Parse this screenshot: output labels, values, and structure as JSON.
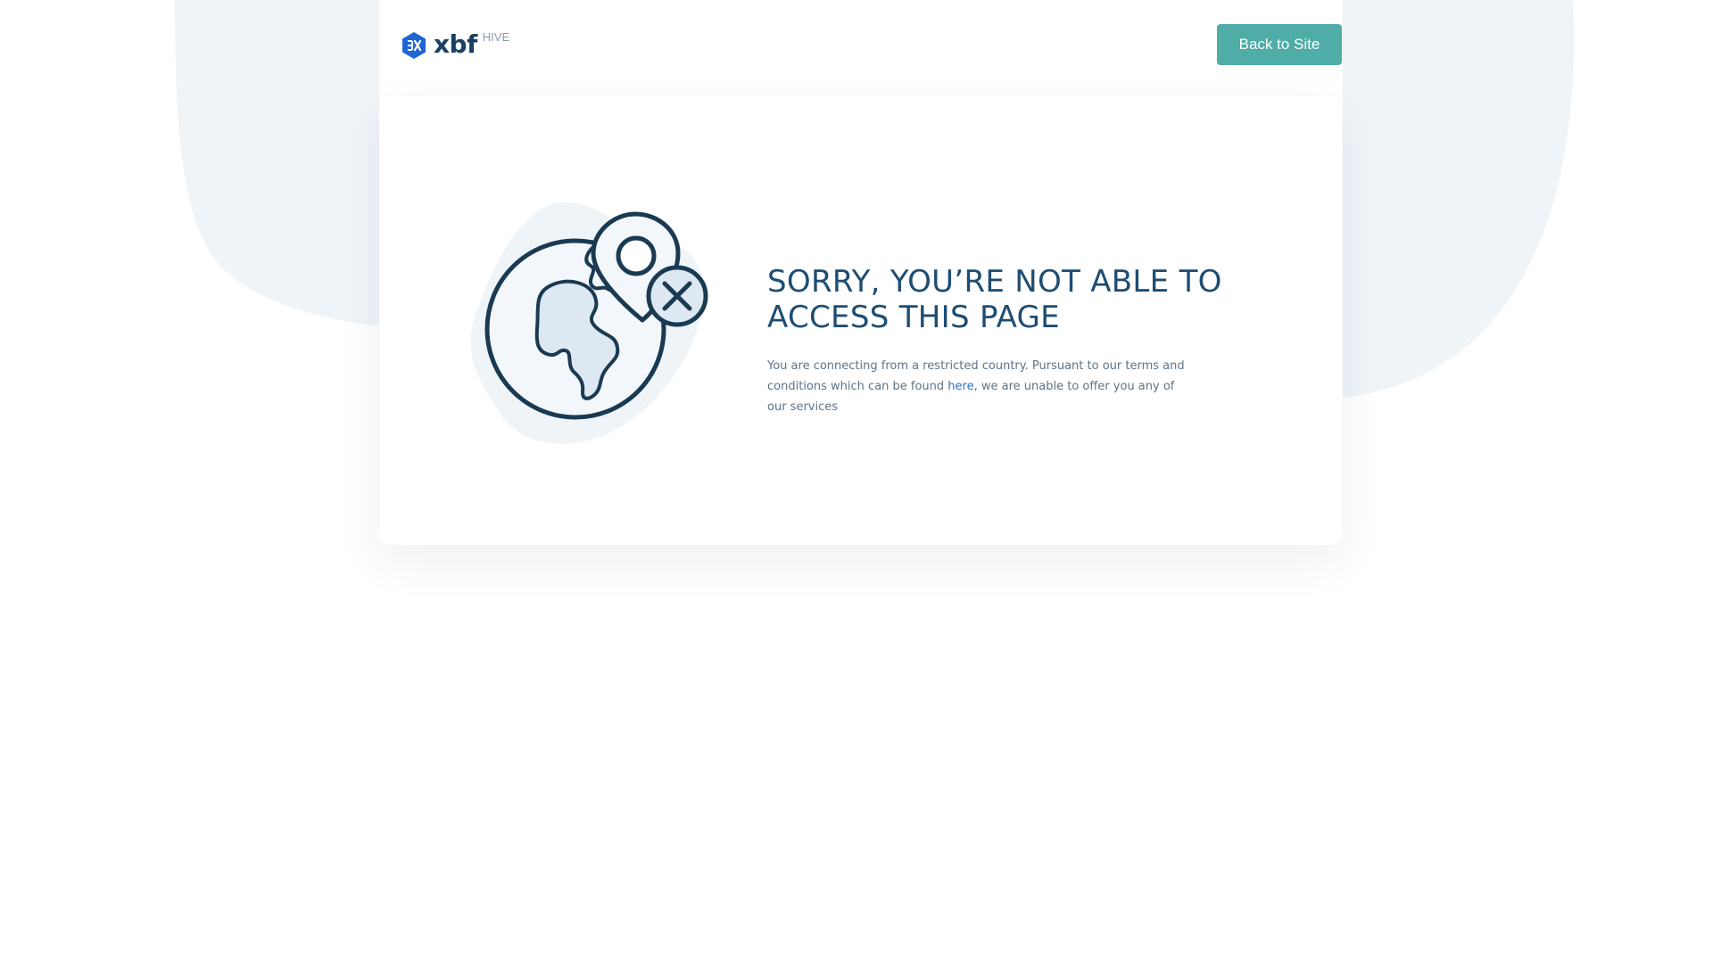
{
  "header": {
    "logo_text": "xbf",
    "logo_sub": "HIVE",
    "back_button": "Back to Site"
  },
  "main": {
    "title": "SORRY, YOU’RE NOT ABLE TO ACCESS THIS PAGE",
    "desc_before": "You are connecting from a restricted country. Pursuant to our terms and conditions which can be found ",
    "desc_link": "here",
    "desc_after": ", we are unable to offer you any of our services"
  },
  "illustration": {
    "icons": [
      "globe-icon",
      "location-pin-icon",
      "close-circle-icon"
    ]
  },
  "colors": {
    "accent": "#4fada8",
    "title": "#1e4d72",
    "link": "#2f6fc4",
    "background_blob": "#eff4f8",
    "logo_icon": "#1e66d6"
  }
}
